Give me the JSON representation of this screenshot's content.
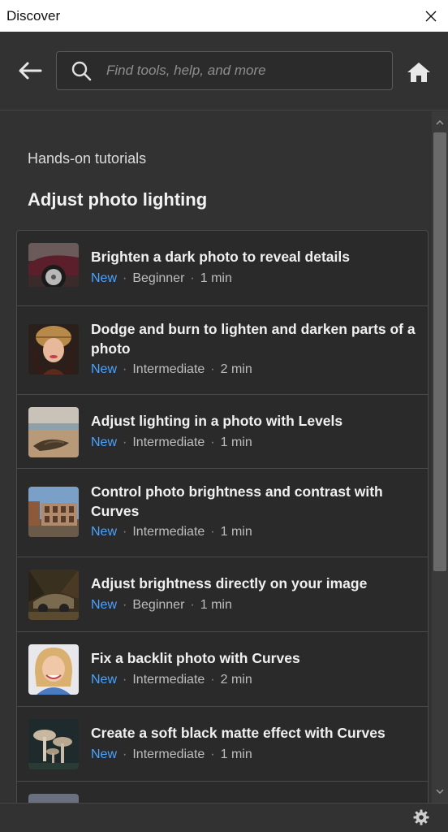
{
  "window": {
    "title": "Discover"
  },
  "search": {
    "placeholder": "Find tools, help, and more"
  },
  "section": {
    "eyebrow": "Hands-on tutorials",
    "title": "Adjust photo lighting"
  },
  "tutorials": [
    {
      "title": "Brighten a dark photo to reveal details",
      "badge": "New",
      "level": "Beginner",
      "duration": "1 min",
      "thumb": "vintage-car-photo"
    },
    {
      "title": "Dodge and burn to lighten and darken parts of a photo",
      "badge": "New",
      "level": "Intermediate",
      "duration": "2 min",
      "thumb": "portrait-woman-knit-hat-photo"
    },
    {
      "title": "Adjust lighting in a photo with Levels",
      "badge": "New",
      "level": "Intermediate",
      "duration": "1 min",
      "thumb": "beach-log-photo"
    },
    {
      "title": "Control photo brightness and contrast with Curves",
      "badge": "New",
      "level": "Intermediate",
      "duration": "1 min",
      "thumb": "colosseum-photo"
    },
    {
      "title": "Adjust brightness directly on your image",
      "badge": "New",
      "level": "Beginner",
      "duration": "1 min",
      "thumb": "abandoned-car-photo"
    },
    {
      "title": "Fix a backlit photo with Curves",
      "badge": "New",
      "level": "Intermediate",
      "duration": "2 min",
      "thumb": "smiling-child-photo"
    },
    {
      "title": "Create a soft black matte effect with Curves",
      "badge": "New",
      "level": "Intermediate",
      "duration": "1 min",
      "thumb": "mushrooms-photo"
    }
  ],
  "colors": {
    "accent": "#4aa3ff",
    "panel": "#323232",
    "card": "#2a2a2a"
  }
}
